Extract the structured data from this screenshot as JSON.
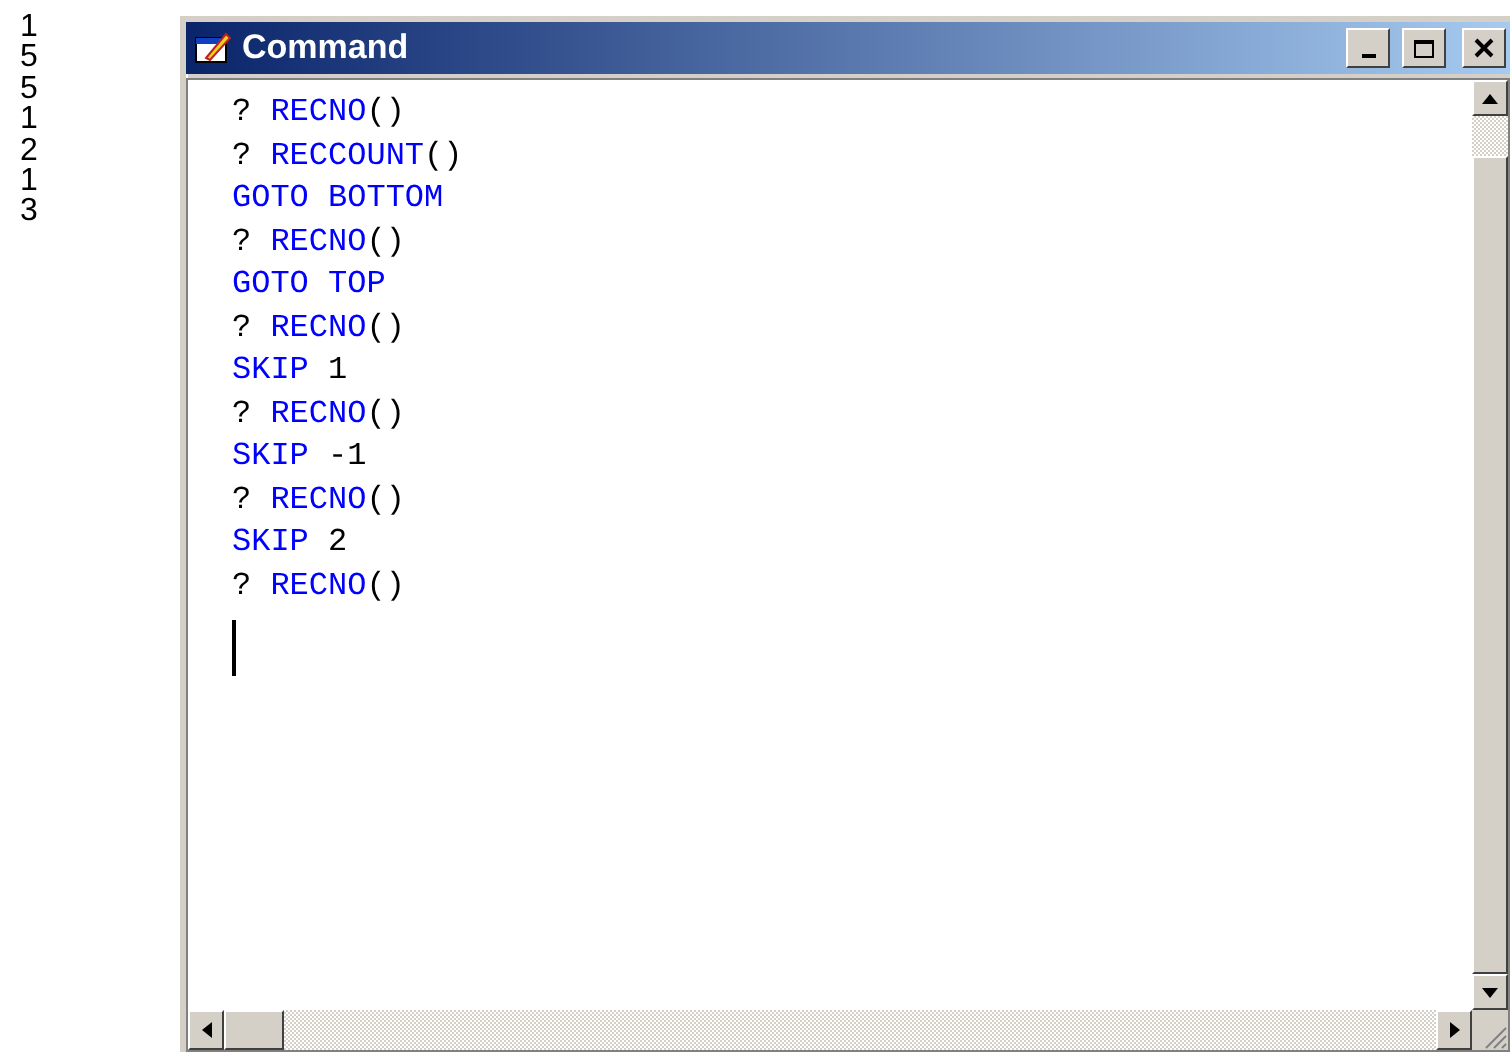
{
  "output_lines": [
    "1",
    "5",
    "5",
    "1",
    "2",
    "1",
    "3"
  ],
  "window": {
    "title": "Command",
    "buttons": [
      {
        "kind": "minimize"
      },
      {
        "kind": "maximize"
      },
      {
        "kind": "close"
      }
    ]
  },
  "code_lines": [
    [
      {
        "text": "? ",
        "kind": "plain"
      },
      {
        "text": "RECNO",
        "kind": "keyword"
      },
      {
        "text": "()",
        "kind": "plain"
      }
    ],
    [
      {
        "text": "? ",
        "kind": "plain"
      },
      {
        "text": "RECCOUNT",
        "kind": "keyword"
      },
      {
        "text": "()",
        "kind": "plain"
      }
    ],
    [
      {
        "text": "GOTO BOTTOM",
        "kind": "keyword"
      }
    ],
    [
      {
        "text": "? ",
        "kind": "plain"
      },
      {
        "text": "RECNO",
        "kind": "keyword"
      },
      {
        "text": "()",
        "kind": "plain"
      }
    ],
    [
      {
        "text": "GOTO TOP",
        "kind": "keyword"
      }
    ],
    [
      {
        "text": "? ",
        "kind": "plain"
      },
      {
        "text": "RECNO",
        "kind": "keyword"
      },
      {
        "text": "()",
        "kind": "plain"
      }
    ],
    [
      {
        "text": "SKIP ",
        "kind": "keyword"
      },
      {
        "text": "1",
        "kind": "plain"
      }
    ],
    [
      {
        "text": "? ",
        "kind": "plain"
      },
      {
        "text": "RECNO",
        "kind": "keyword"
      },
      {
        "text": "()",
        "kind": "plain"
      }
    ],
    [
      {
        "text": "SKIP ",
        "kind": "keyword"
      },
      {
        "text": "-1",
        "kind": "plain"
      }
    ],
    [
      {
        "text": "? ",
        "kind": "plain"
      },
      {
        "text": "RECNO",
        "kind": "keyword"
      },
      {
        "text": "()",
        "kind": "plain"
      }
    ],
    [
      {
        "text": "SKIP ",
        "kind": "keyword"
      },
      {
        "text": "2",
        "kind": "plain"
      }
    ],
    [
      {
        "text": "? ",
        "kind": "plain"
      },
      {
        "text": "RECNO",
        "kind": "keyword"
      },
      {
        "text": "()",
        "kind": "plain"
      }
    ]
  ]
}
